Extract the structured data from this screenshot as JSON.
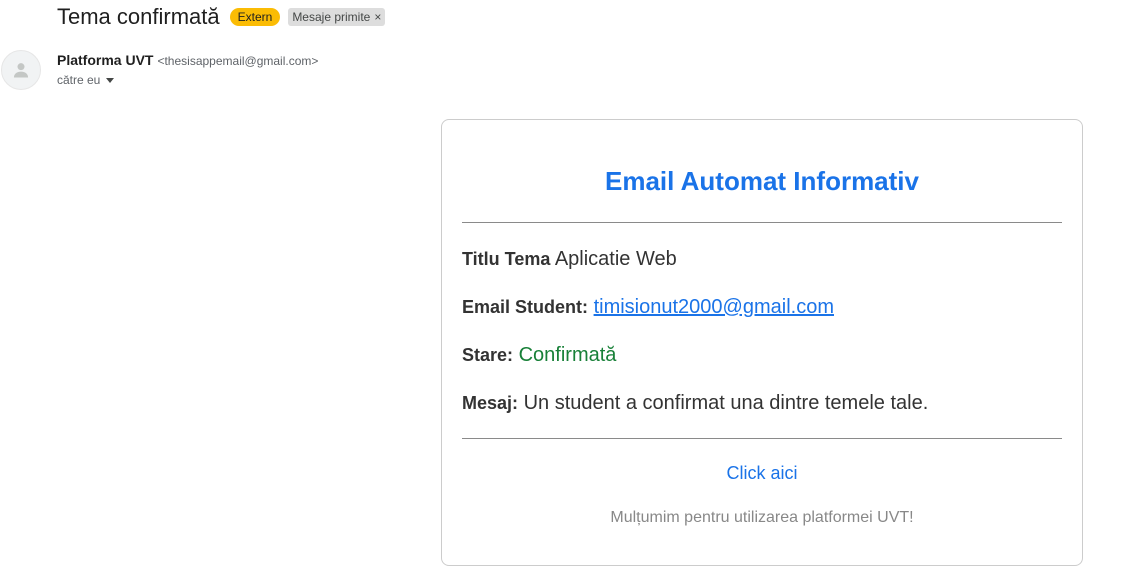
{
  "email": {
    "subject": "Tema confirmată",
    "labels": {
      "extern": "Extern",
      "inbox": "Mesaje primite",
      "remove": "×"
    },
    "sender": {
      "name": "Platforma UVT",
      "address": "<thesisappemail@gmail.com>",
      "avatar_icon": "person-icon"
    },
    "recipient": "către eu"
  },
  "card": {
    "title": "Email Automat Informativ",
    "fields": {
      "title_label": "Titlu Tema",
      "title_value": "Aplicatie Web",
      "email_label": "Email Student:",
      "email_value": "timisionut2000@gmail.com",
      "status_label": "Stare:",
      "status_value": "Confirmată",
      "message_label": "Mesaj:",
      "message_value": "Un student a confirmat una dintre temele tale."
    },
    "cta": "Click aici",
    "footer": "Mulțumim pentru utilizarea platformei UVT!"
  },
  "colors": {
    "accent": "#1a73e8",
    "status_ok": "#188038",
    "badge_extern": "#fbbc04",
    "badge_inbox": "#dddddd"
  }
}
